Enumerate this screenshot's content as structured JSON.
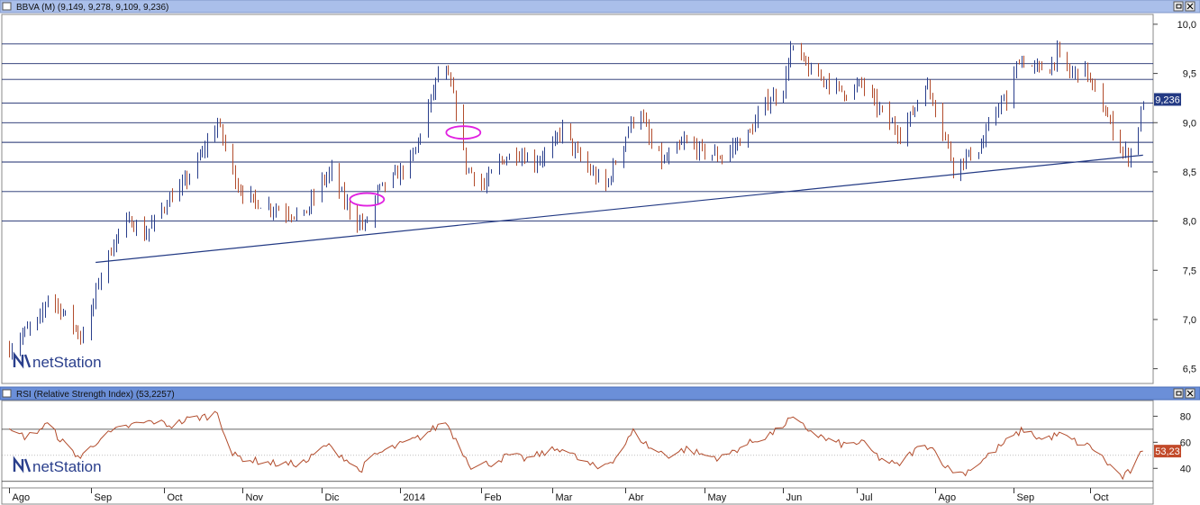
{
  "window": {
    "main_title": "BBVA (M) (9,149, 9,278, 9,109, 9,236)",
    "rsi_title": "RSI (Relative Strength Index) (53,2257)",
    "watermark": "netStation",
    "title_bar_color": "#aabfea",
    "rsi_title_bar_color": "#6b8fd8",
    "bar_color_up": "#2a3f8c",
    "bar_color_down": "#b24c2c",
    "trendline_color": "#233a84",
    "ellipse_color": "#e020e0"
  },
  "chart_data": [
    {
      "type": "ohlc",
      "title": "BBVA (M) (9,149, 9,278, 9,109, 9,236)",
      "ylim": [
        6.35,
        10.1
      ],
      "y_ticks": [
        6.5,
        7.0,
        7.5,
        8.0,
        8.5,
        9.0,
        9.5,
        10.0
      ],
      "y_tick_labels": [
        "6,5",
        "7,0",
        "7,5",
        "8,0",
        "8,5",
        "9,0",
        "9,5",
        "10,0"
      ],
      "last_value": 9.236,
      "last_value_label": "9,236",
      "horizontal_levels": [
        9.8,
        9.6,
        9.44,
        9.2,
        9.0,
        8.8,
        8.6,
        8.3,
        8.0
      ],
      "trendline": [
        {
          "date": "2013-09-04",
          "y": 7.58
        },
        {
          "date": "2014-10-22",
          "y": 8.67
        }
      ],
      "ellipses": [
        {
          "date": "2013-12-20",
          "y": 8.22
        },
        {
          "date": "2014-01-27",
          "y": 8.9
        }
      ],
      "anchors": [
        [
          "2013-08-01",
          6.7
        ],
        [
          "2013-08-06",
          6.85
        ],
        [
          "2013-08-13",
          7.0
        ],
        [
          "2013-08-16",
          7.25
        ],
        [
          "2013-08-21",
          7.1
        ],
        [
          "2013-08-26",
          6.95
        ],
        [
          "2013-08-29",
          6.82
        ],
        [
          "2013-09-02",
          7.05
        ],
        [
          "2013-09-05",
          7.4
        ],
        [
          "2013-09-09",
          7.65
        ],
        [
          "2013-09-13",
          7.9
        ],
        [
          "2013-09-18",
          8.0
        ],
        [
          "2013-09-23",
          7.85
        ],
        [
          "2013-09-27",
          8.0
        ],
        [
          "2013-10-02",
          8.2
        ],
        [
          "2013-10-08",
          8.35
        ],
        [
          "2013-10-14",
          8.6
        ],
        [
          "2013-10-18",
          8.8
        ],
        [
          "2013-10-22",
          9.0
        ],
        [
          "2013-10-25",
          8.75
        ],
        [
          "2013-10-30",
          8.35
        ],
        [
          "2013-11-05",
          8.2
        ],
        [
          "2013-11-11",
          8.15
        ],
        [
          "2013-11-18",
          8.1
        ],
        [
          "2013-11-25",
          8.05
        ],
        [
          "2013-12-02",
          8.4
        ],
        [
          "2013-12-06",
          8.5
        ],
        [
          "2013-12-11",
          8.2
        ],
        [
          "2013-12-16",
          8.0
        ],
        [
          "2013-12-19",
          7.95
        ],
        [
          "2013-12-24",
          8.3
        ],
        [
          "2014-01-02",
          8.5
        ],
        [
          "2014-01-07",
          8.65
        ],
        [
          "2014-01-13",
          9.15
        ],
        [
          "2014-01-17",
          9.5
        ],
        [
          "2014-01-21",
          9.45
        ],
        [
          "2014-01-24",
          9.15
        ],
        [
          "2014-01-28",
          8.55
        ],
        [
          "2014-02-04",
          8.35
        ],
        [
          "2014-02-10",
          8.6
        ],
        [
          "2014-02-17",
          8.7
        ],
        [
          "2014-02-24",
          8.6
        ],
        [
          "2014-03-03",
          8.75
        ],
        [
          "2014-03-07",
          8.95
        ],
        [
          "2014-03-12",
          8.7
        ],
        [
          "2014-03-18",
          8.5
        ],
        [
          "2014-03-24",
          8.35
        ],
        [
          "2014-03-28",
          8.6
        ],
        [
          "2014-04-03",
          9.0
        ],
        [
          "2014-04-07",
          9.1
        ],
        [
          "2014-04-11",
          8.75
        ],
        [
          "2014-04-16",
          8.6
        ],
        [
          "2014-04-24",
          8.8
        ],
        [
          "2014-05-02",
          8.7
        ],
        [
          "2014-05-09",
          8.65
        ],
        [
          "2014-05-15",
          8.8
        ],
        [
          "2014-05-20",
          8.9
        ],
        [
          "2014-05-26",
          9.2
        ],
        [
          "2014-06-02",
          9.35
        ],
        [
          "2014-06-05",
          9.75
        ],
        [
          "2014-06-09",
          9.65
        ],
        [
          "2014-06-13",
          9.5
        ],
        [
          "2014-06-18",
          9.45
        ],
        [
          "2014-06-23",
          9.35
        ],
        [
          "2014-06-27",
          9.3
        ],
        [
          "2014-07-03",
          9.4
        ],
        [
          "2014-07-08",
          9.2
        ],
        [
          "2014-07-14",
          9.0
        ],
        [
          "2014-07-18",
          8.9
        ],
        [
          "2014-07-23",
          9.1
        ],
        [
          "2014-07-28",
          9.4
        ],
        [
          "2014-07-31",
          9.25
        ],
        [
          "2014-08-05",
          8.85
        ],
        [
          "2014-08-08",
          8.55
        ],
        [
          "2014-08-13",
          8.65
        ],
        [
          "2014-08-19",
          8.75
        ],
        [
          "2014-08-26",
          9.2
        ],
        [
          "2014-08-29",
          9.2
        ],
        [
          "2014-09-03",
          9.65
        ],
        [
          "2014-09-09",
          9.55
        ],
        [
          "2014-09-15",
          9.55
        ],
        [
          "2014-09-18",
          9.7
        ],
        [
          "2014-09-23",
          9.5
        ],
        [
          "2014-09-29",
          9.55
        ],
        [
          "2014-10-03",
          9.3
        ],
        [
          "2014-10-08",
          9.05
        ],
        [
          "2014-10-13",
          8.75
        ],
        [
          "2014-10-16",
          8.65
        ],
        [
          "2014-10-20",
          8.95
        ],
        [
          "2014-10-22",
          9.236
        ]
      ]
    },
    {
      "type": "line",
      "title": "RSI (Relative Strength Index) (53,2257)",
      "ylim": [
        25,
        92
      ],
      "y_ticks": [
        40,
        60,
        80
      ],
      "y_tick_labels": [
        "40",
        "60",
        "80"
      ],
      "reference_lines": [
        70,
        30
      ],
      "last_value": 53.2257,
      "last_value_label": "53,23",
      "x_ticks": [
        {
          "date": "2013-08-01",
          "label": "Ago"
        },
        {
          "date": "2013-09-02",
          "label": "Sep"
        },
        {
          "date": "2013-10-01",
          "label": "Oct"
        },
        {
          "date": "2013-11-01",
          "label": "Nov"
        },
        {
          "date": "2013-12-02",
          "label": "Dic"
        },
        {
          "date": "2014-01-02",
          "label": "2014"
        },
        {
          "date": "2014-02-03",
          "label": "Feb"
        },
        {
          "date": "2014-03-03",
          "label": "Mar"
        },
        {
          "date": "2014-04-01",
          "label": "Abr"
        },
        {
          "date": "2014-05-02",
          "label": "May"
        },
        {
          "date": "2014-06-02",
          "label": "Jun"
        },
        {
          "date": "2014-07-01",
          "label": "Jul"
        },
        {
          "date": "2014-08-01",
          "label": "Ago"
        },
        {
          "date": "2014-09-01",
          "label": "Sep"
        },
        {
          "date": "2014-10-01",
          "label": "Oct"
        }
      ],
      "anchors": [
        [
          "2013-08-01",
          68
        ],
        [
          "2013-08-08",
          64
        ],
        [
          "2013-08-16",
          74
        ],
        [
          "2013-08-23",
          58
        ],
        [
          "2013-08-29",
          48
        ],
        [
          "2013-09-05",
          62
        ],
        [
          "2013-09-13",
          70
        ],
        [
          "2013-09-20",
          74
        ],
        [
          "2013-09-27",
          76
        ],
        [
          "2013-10-04",
          73
        ],
        [
          "2013-10-11",
          78
        ],
        [
          "2013-10-18",
          80
        ],
        [
          "2013-10-22",
          83
        ],
        [
          "2013-10-28",
          50
        ],
        [
          "2013-11-05",
          46
        ],
        [
          "2013-11-12",
          44
        ],
        [
          "2013-11-19",
          43
        ],
        [
          "2013-11-26",
          45
        ],
        [
          "2013-12-04",
          58
        ],
        [
          "2013-12-10",
          50
        ],
        [
          "2013-12-17",
          38
        ],
        [
          "2013-12-23",
          50
        ],
        [
          "2014-01-02",
          58
        ],
        [
          "2014-01-09",
          63
        ],
        [
          "2014-01-15",
          70
        ],
        [
          "2014-01-20",
          76
        ],
        [
          "2014-01-24",
          62
        ],
        [
          "2014-01-30",
          42
        ],
        [
          "2014-02-07",
          44
        ],
        [
          "2014-02-14",
          50
        ],
        [
          "2014-02-21",
          47
        ],
        [
          "2014-02-28",
          52
        ],
        [
          "2014-03-07",
          56
        ],
        [
          "2014-03-14",
          46
        ],
        [
          "2014-03-21",
          40
        ],
        [
          "2014-03-28",
          48
        ],
        [
          "2014-04-04",
          68
        ],
        [
          "2014-04-11",
          55
        ],
        [
          "2014-04-18",
          50
        ],
        [
          "2014-04-25",
          55
        ],
        [
          "2014-05-02",
          50
        ],
        [
          "2014-05-09",
          48
        ],
        [
          "2014-05-16",
          56
        ],
        [
          "2014-05-23",
          62
        ],
        [
          "2014-05-30",
          68
        ],
        [
          "2014-06-05",
          78
        ],
        [
          "2014-06-12",
          70
        ],
        [
          "2014-06-19",
          62
        ],
        [
          "2014-06-26",
          58
        ],
        [
          "2014-07-03",
          60
        ],
        [
          "2014-07-10",
          48
        ],
        [
          "2014-07-17",
          42
        ],
        [
          "2014-07-24",
          54
        ],
        [
          "2014-07-30",
          58
        ],
        [
          "2014-08-06",
          40
        ],
        [
          "2014-08-12",
          36
        ],
        [
          "2014-08-19",
          45
        ],
        [
          "2014-08-26",
          56
        ],
        [
          "2014-09-02",
          66
        ],
        [
          "2014-09-05",
          70
        ],
        [
          "2014-09-12",
          62
        ],
        [
          "2014-09-19",
          66
        ],
        [
          "2014-09-26",
          60
        ],
        [
          "2014-10-02",
          56
        ],
        [
          "2014-10-08",
          44
        ],
        [
          "2014-10-14",
          33
        ],
        [
          "2014-10-17",
          38
        ],
        [
          "2014-10-22",
          53.2257
        ]
      ]
    }
  ]
}
